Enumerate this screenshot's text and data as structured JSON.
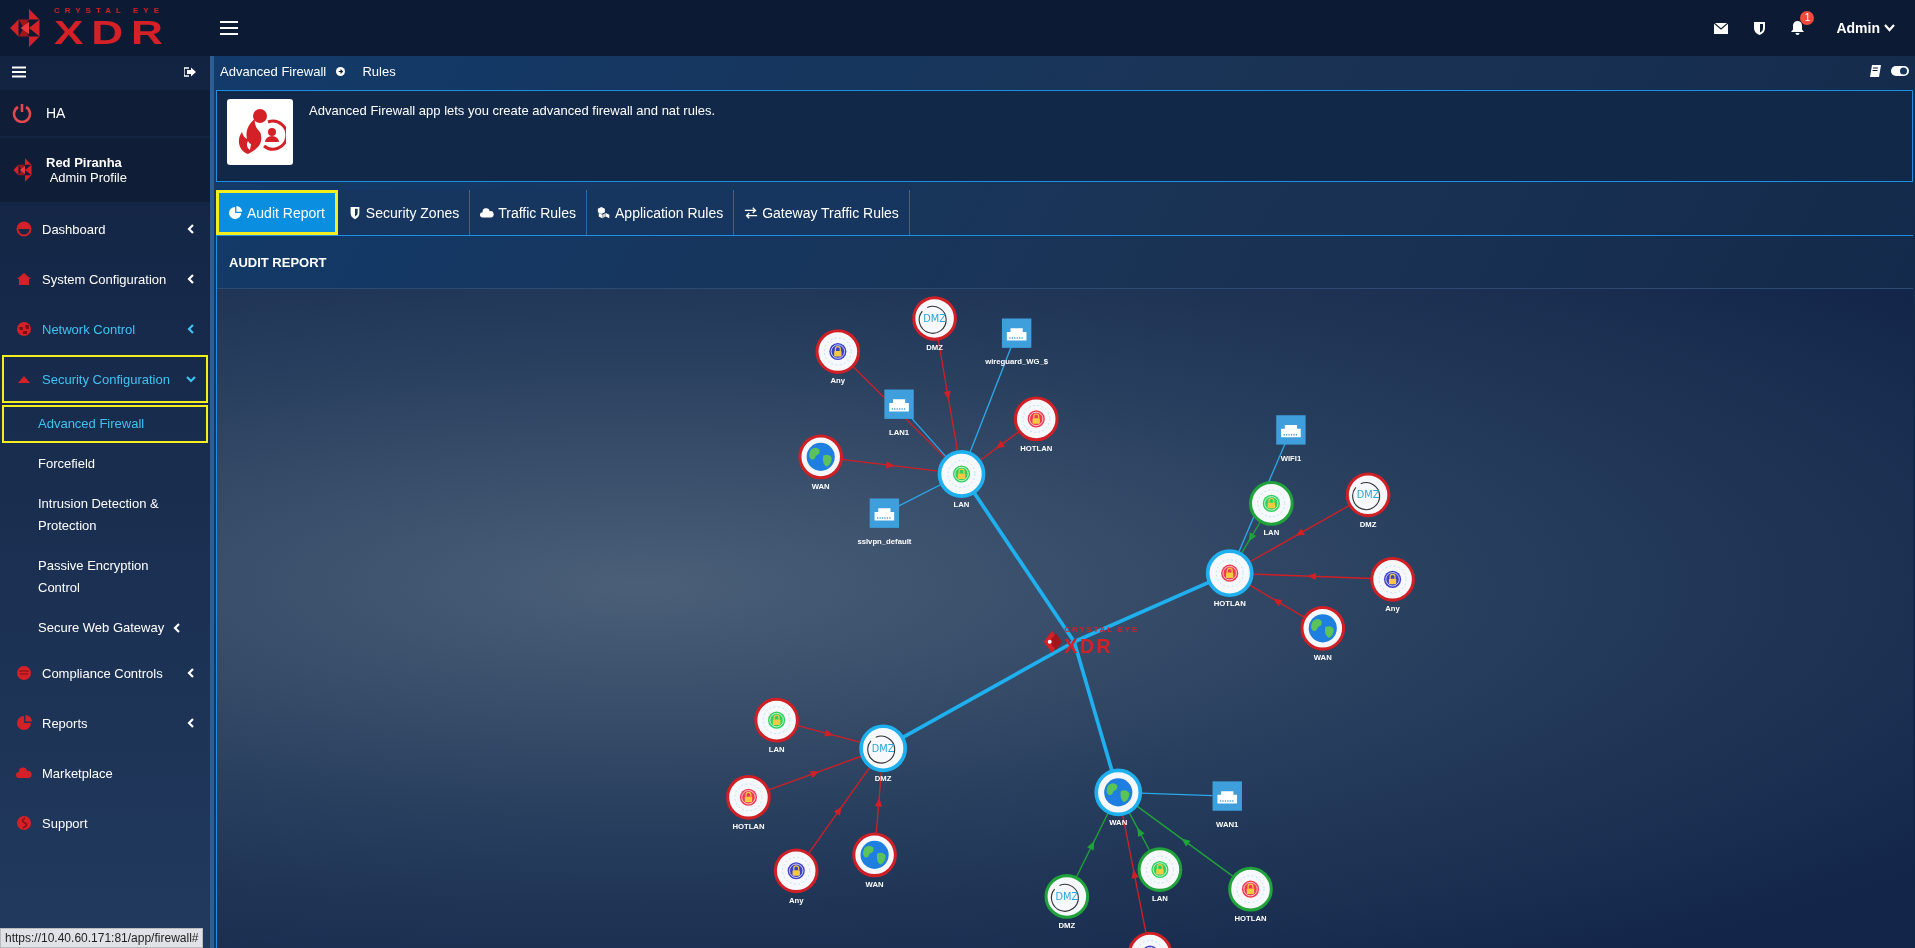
{
  "logo": {
    "tagline": "CRYSTAL EYE",
    "wordmark": "XDR"
  },
  "sidebar": {
    "ha_label": "HA",
    "profile": {
      "name": "Red Piranha",
      "role": "Admin Profile"
    },
    "items": [
      {
        "label": "Dashboard",
        "kind": "group",
        "expanded": false,
        "active": false,
        "selected": false
      },
      {
        "label": "System Configuration",
        "kind": "group",
        "expanded": false,
        "active": false,
        "selected": false
      },
      {
        "label": "Network Control",
        "kind": "group",
        "expanded": false,
        "active": true,
        "selected": false
      },
      {
        "label": "Security Configuration",
        "kind": "group",
        "expanded": true,
        "active": true,
        "selected": true,
        "children": [
          {
            "label": "Advanced Firewall",
            "kind": "link",
            "selected": true
          },
          {
            "label": "Forcefield",
            "kind": "link",
            "selected": false
          },
          {
            "label": "Intrusion Detection & Protection",
            "kind": "link",
            "selected": false
          },
          {
            "label": "Passive Encryption Control",
            "kind": "link",
            "selected": false
          },
          {
            "label": "Secure Web Gateway",
            "kind": "group",
            "selected": false
          }
        ]
      },
      {
        "label": "Compliance Controls",
        "kind": "group",
        "expanded": false,
        "active": false,
        "selected": false
      },
      {
        "label": "Reports",
        "kind": "group",
        "expanded": false,
        "active": false,
        "selected": false
      },
      {
        "label": "Marketplace",
        "kind": "link",
        "active": false,
        "selected": false
      },
      {
        "label": "Support",
        "kind": "link",
        "active": false,
        "selected": false
      }
    ]
  },
  "topbar": {
    "notifications": "1",
    "user": "Admin"
  },
  "breadcrumb": [
    "Advanced Firewall",
    "Rules"
  ],
  "view_toggle": {
    "on": true
  },
  "info": {
    "text": "Advanced Firewall app lets you create advanced firewall and nat rules."
  },
  "tabs": [
    {
      "label": "Audit Report",
      "selected": true
    },
    {
      "label": "Security Zones",
      "selected": false
    },
    {
      "label": "Traffic Rules",
      "selected": false
    },
    {
      "label": "Application Rules",
      "selected": false
    },
    {
      "label": "Gateway Traffic Rules",
      "selected": false
    }
  ],
  "panel": {
    "title": "AUDIT REPORT",
    "graph": {
      "center_logo": {
        "tagline": "CRYSTAL EYE",
        "wordmark": "XDR"
      },
      "hubs": [
        {
          "label": "LAN",
          "kind": "lan",
          "satellites": [
            {
              "label": "DMZ",
              "kind": "dmz",
              "icon_text": "DMZ",
              "allowed": false
            },
            {
              "label": "wireguard_WG_$",
              "kind": "interface"
            },
            {
              "label": "Any",
              "kind": "any",
              "allowed": false
            },
            {
              "label": "LAN1",
              "kind": "interface"
            },
            {
              "label": "HOTLAN",
              "kind": "hotlan",
              "allowed": false
            },
            {
              "label": "WAN",
              "kind": "wan",
              "allowed": false
            },
            {
              "label": "sslvpn_default",
              "kind": "interface"
            }
          ]
        },
        {
          "label": "HOTLAN",
          "kind": "hotlan",
          "satellites": [
            {
              "label": "WIFI1",
              "kind": "interface"
            },
            {
              "label": "LAN",
              "kind": "lan",
              "allowed": true
            },
            {
              "label": "DMZ",
              "kind": "dmz",
              "icon_text": "DMZ",
              "allowed": false
            },
            {
              "label": "Any",
              "kind": "any",
              "allowed": false
            },
            {
              "label": "WAN",
              "kind": "wan",
              "allowed": false
            }
          ]
        },
        {
          "label": "DMZ",
          "kind": "dmz",
          "icon_text": "DMZ",
          "satellites": [
            {
              "label": "LAN",
              "kind": "lan",
              "allowed": false
            },
            {
              "label": "HOTLAN",
              "kind": "hotlan",
              "allowed": false
            },
            {
              "label": "Any",
              "kind": "any",
              "allowed": false
            },
            {
              "label": "WAN",
              "kind": "wan",
              "allowed": false
            }
          ]
        },
        {
          "label": "WAN",
          "kind": "wan",
          "satellites": [
            {
              "label": "WAN1",
              "kind": "interface"
            },
            {
              "label": "DMZ",
              "kind": "dmz",
              "icon_text": "DMZ",
              "allowed": true
            },
            {
              "label": "LAN",
              "kind": "lan",
              "allowed": true
            },
            {
              "label": "HOTLAN",
              "kind": "hotlan",
              "allowed": true
            },
            {
              "kind": "any",
              "allowed": false
            }
          ]
        }
      ]
    }
  },
  "status_bar": {
    "url": "https://10.40.60.171:81/app/firewall#"
  }
}
